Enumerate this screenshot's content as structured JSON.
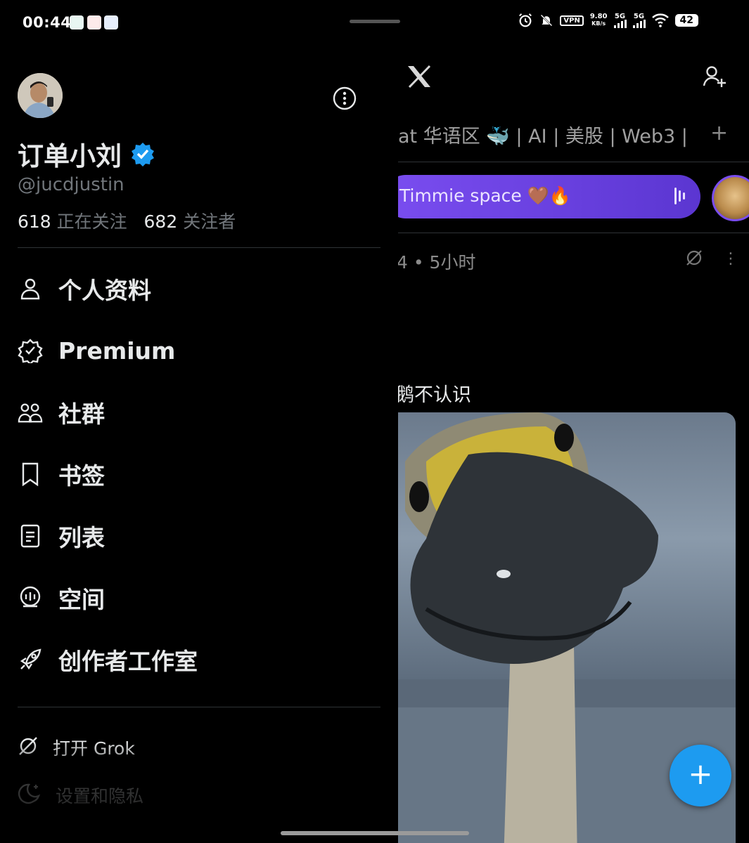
{
  "status_bar": {
    "time": "00:44",
    "vpn": "VPN",
    "speed_value": "9.80",
    "speed_unit": "KB/s",
    "signal1": "5G",
    "signal2": "5G",
    "battery": "42"
  },
  "timeline": {
    "tabs_text": "at 华语区 🐳 | AI | 美股 | Web3 |",
    "tabs_add": "+",
    "space_label": "Timmie space 🤎🔥",
    "post_meta": "4 • 5小时",
    "post_text": "鹅不认识",
    "fab_label": "+",
    "colors": {
      "accent": "#1d9bf0",
      "space": "#6a42e0"
    }
  },
  "drawer": {
    "name": "订单小刘",
    "handle": "@jucdjustin",
    "following_count": "618",
    "following_label": "正在关注",
    "followers_count": "682",
    "followers_label": "关注者",
    "menu": [
      {
        "label": "个人资料",
        "icon": "profile-icon"
      },
      {
        "label": "Premium",
        "icon": "premium-icon"
      },
      {
        "label": "社群",
        "icon": "communities-icon"
      },
      {
        "label": "书签",
        "icon": "bookmark-icon"
      },
      {
        "label": "列表",
        "icon": "lists-icon"
      },
      {
        "label": "空间",
        "icon": "spaces-icon"
      },
      {
        "label": "创作者工作室",
        "icon": "rocket-icon"
      }
    ],
    "secondary": [
      {
        "label": "打开 Grok",
        "icon": "grok-icon"
      },
      {
        "label": "设置和隐私",
        "icon": "moon-icon"
      }
    ]
  }
}
